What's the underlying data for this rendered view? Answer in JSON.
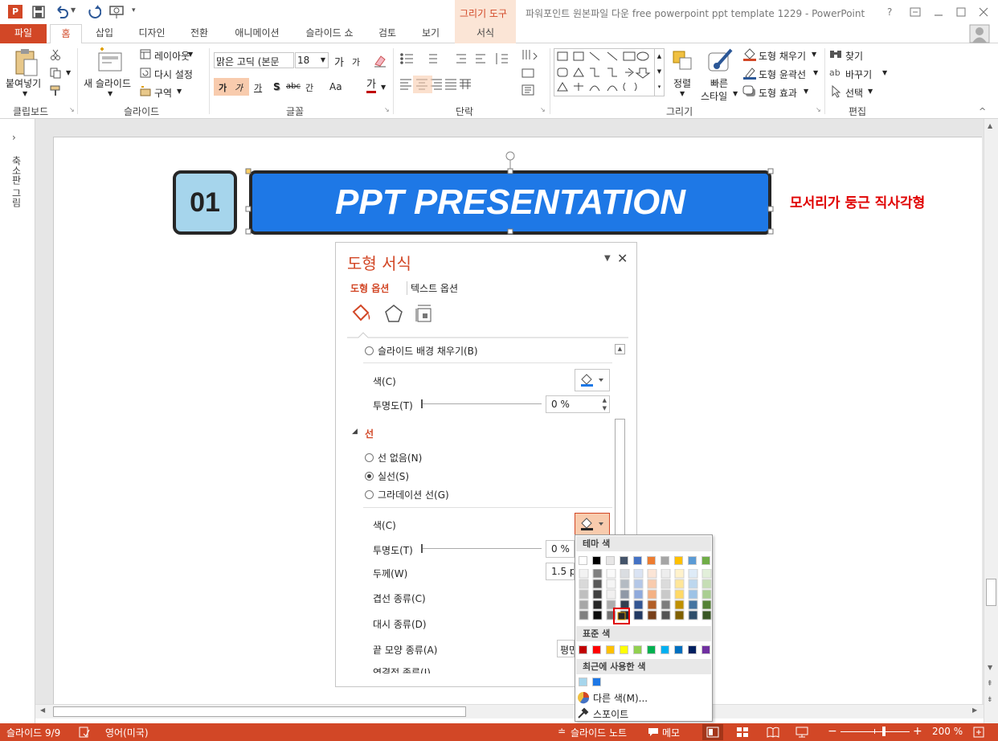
{
  "title_bar": {
    "tool_context": "그리기 도구",
    "title": "파워포인트 원본파일 다운 free powerpoint ppt template 1229 - PowerPoint",
    "help": "?",
    "app_icon": "P"
  },
  "tabs": {
    "file": "파일",
    "home": "홈",
    "insert": "삽입",
    "design": "디자인",
    "transitions": "전환",
    "animations": "애니메이션",
    "slideshow": "슬라이드 쇼",
    "review": "검토",
    "view": "보기",
    "format": "서식"
  },
  "ribbon": {
    "clipboard": {
      "paste": "붙여넣기",
      "label": "클립보드"
    },
    "slides": {
      "new_slide": "새 슬라이드",
      "layout": "레이아웃",
      "reset": "다시 설정",
      "section": "구역",
      "label": "슬라이드"
    },
    "font": {
      "font_name": "맑은 고딕 (본문",
      "font_size": "18",
      "grow": "가",
      "shrink": "가",
      "label": "글꼴",
      "bold": "가",
      "italic": "가",
      "underline": "가",
      "shadow": "S",
      "strike": "abc",
      "spacing": "간",
      "case": "Aa",
      "color": "가"
    },
    "paragraph": {
      "label": "단락"
    },
    "drawing": {
      "arrange": "정렬",
      "quick_styles_1": "빠른",
      "quick_styles_2": "스타일",
      "fill": "도형 채우기",
      "outline": "도형 윤곽선",
      "effects": "도형 효과",
      "label": "그리기"
    },
    "editing": {
      "find": "찾기",
      "replace": "바꾸기",
      "select": "선택",
      "label": "편집"
    }
  },
  "thumbnails_label": "축소판 그림",
  "slide": {
    "number_box": "01",
    "title": "PPT PRESENTATION",
    "annotation": "모서리가 둥근 직사각형"
  },
  "format_pane": {
    "title": "도형 서식",
    "tab_shape": "도형 옵션",
    "tab_text": "텍스트 옵션",
    "slide_bg_fill": "슬라이드 배경 채우기(B)",
    "fill_color": "색(C)",
    "fill_transparency": "투명도(T)",
    "fill_transparency_value": "0 %",
    "line_section": "선",
    "no_line": "선 없음(N)",
    "solid_line": "실선(S)",
    "gradient_line": "그라데이션 선(G)",
    "line_color": "색(C)",
    "line_transparency": "투명도(T)",
    "line_transparency_value": "0 %",
    "width": "두께(W)",
    "width_value": "1.5 pt",
    "compound": "겹선 종류(C)",
    "dash": "대시 종류(D)",
    "cap": "끝 모양 종류(A)",
    "cap_value": "평면",
    "join": "연결점 종류(J)"
  },
  "color_popup": {
    "theme_colors": "테마 색",
    "standard_colors": "표준 색",
    "recent_colors": "최근에 사용한 색",
    "more_colors": "다른 색(M)...",
    "eyedropper": "스포이트",
    "theme_top": [
      "#ffffff",
      "#000000",
      "#e7e6e6",
      "#44546a",
      "#4472c4",
      "#ed7d31",
      "#a5a5a5",
      "#ffc000",
      "#5b9bd5",
      "#70ad47"
    ],
    "standard": [
      "#c00000",
      "#ff0000",
      "#ffc000",
      "#ffff00",
      "#92d050",
      "#00b050",
      "#00b0f0",
      "#0070c0",
      "#002060",
      "#7030a0"
    ],
    "recent": [
      "#a6d5ec",
      "#1e78e6"
    ]
  },
  "status_bar": {
    "slide_info": "슬라이드 9/9",
    "language": "영어(미국)",
    "notes": "슬라이드 노트",
    "comments": "메모",
    "zoom": "200 %"
  },
  "colors": {
    "accent": "#d24726",
    "title_fill": "#1e78e6",
    "number_fill": "#a6d5ec",
    "annotation": "#e00000"
  }
}
